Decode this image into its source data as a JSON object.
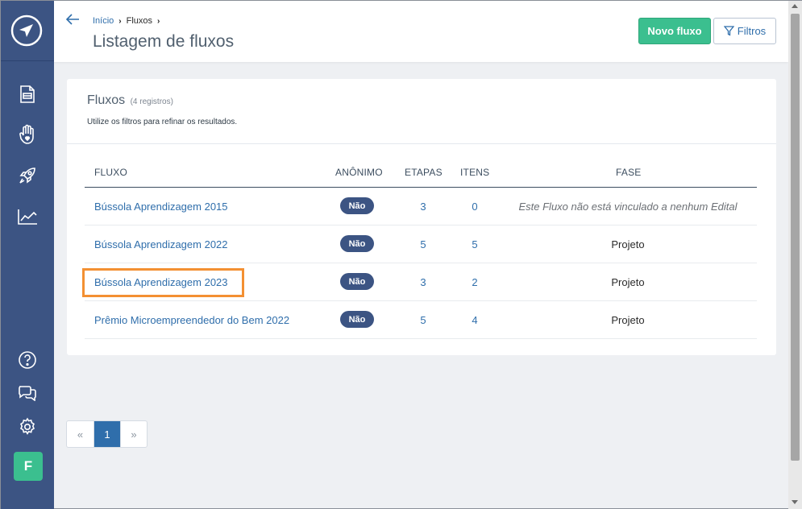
{
  "colors": {
    "sidebar": "#3c5483",
    "primary_green": "#3bbf8f",
    "link_blue": "#2f6eab",
    "highlight": "#f39032"
  },
  "sidebar": {
    "icons": [
      "logo-icon",
      "document-icon",
      "heart-hand-icon",
      "rocket-icon",
      "chart-icon",
      "help-icon",
      "chat-icon",
      "gear-icon"
    ],
    "avatar": "F"
  },
  "header": {
    "breadcrumb": [
      {
        "label": "Início"
      },
      {
        "label": "Fluxos"
      }
    ],
    "title": "Listagem de fluxos",
    "new_button": "Novo fluxo",
    "filter_button": "Filtros"
  },
  "card": {
    "title": "Fluxos",
    "count": "(4 registros)",
    "subtitle": "Utilize os filtros para refinar os resultados."
  },
  "table": {
    "columns": [
      "FLUXO",
      "ANÔNIMO",
      "ETAPAS",
      "ITENS",
      "FASE"
    ],
    "rows": [
      {
        "fluxo": "Bússola Aprendizagem 2015",
        "anonimo": "Não",
        "etapas": "3",
        "itens": "0",
        "fase": "Este Fluxo não está vinculado a nenhum Edital"
      },
      {
        "fluxo": "Bússola Aprendizagem 2022",
        "anonimo": "Não",
        "etapas": "5",
        "itens": "5",
        "fase": "Projeto"
      },
      {
        "fluxo": "Bússola Aprendizagem 2023",
        "anonimo": "Não",
        "etapas": "3",
        "itens": "2",
        "fase": "Projeto"
      },
      {
        "fluxo": "Prêmio Microempreendedor do Bem 2022",
        "anonimo": "Não",
        "etapas": "5",
        "itens": "4",
        "fase": "Projeto"
      }
    ]
  },
  "pagination": {
    "prev": "«",
    "current": "1",
    "next": "»"
  }
}
